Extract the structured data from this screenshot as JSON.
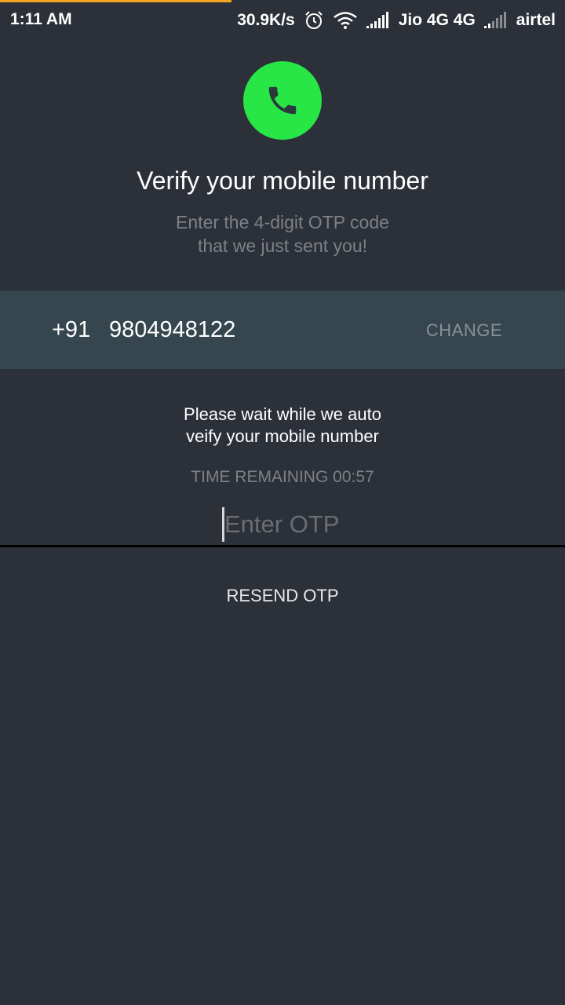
{
  "status_bar": {
    "time": "1:11 AM",
    "net_speed": "30.9K/s",
    "carrier1": "Jio 4G 4G",
    "carrier2": "airtel",
    "icons": [
      "alarm-icon",
      "wifi-icon",
      "signal-icon",
      "signal-weak-icon"
    ]
  },
  "header": {
    "icon": "phone-icon",
    "title": "Verify your mobile number",
    "subtitle_line1": "Enter the 4-digit OTP code",
    "subtitle_line2": "that we just sent you!"
  },
  "phone": {
    "country_code": "+91",
    "number": "9804948122",
    "change_label": "CHANGE"
  },
  "verification": {
    "wait_line1": "Please wait while we auto",
    "wait_line2": "veify your mobile number",
    "timer": "TIME REMAINING 00:57",
    "otp_placeholder": "Enter OTP",
    "otp_value": "",
    "resend_label": "RESEND OTP"
  },
  "colors": {
    "background": "#2c3038",
    "band": "#36464e",
    "accent_green": "#27e645",
    "progress_orange": "#f5a623"
  }
}
